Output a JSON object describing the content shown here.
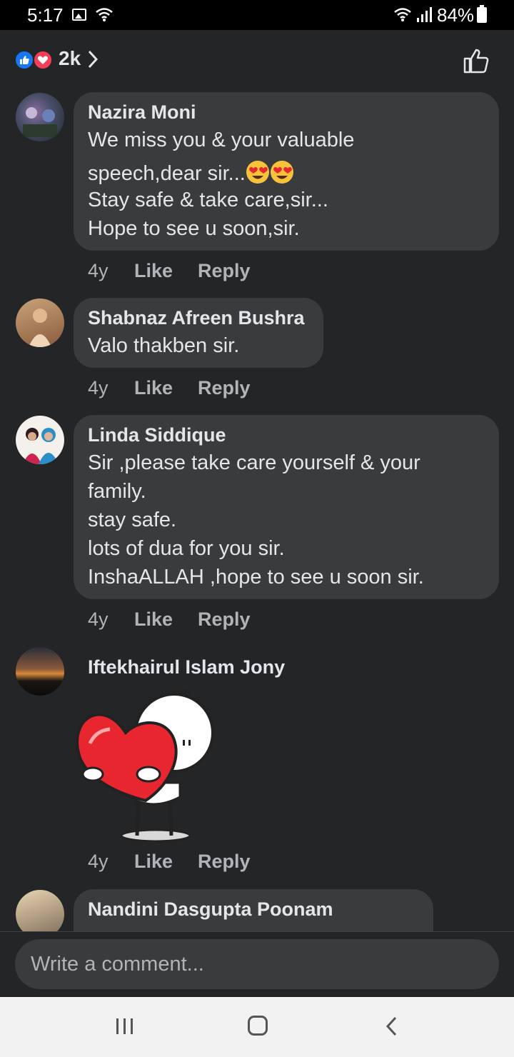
{
  "status_bar": {
    "time": "5:17",
    "battery": "84%"
  },
  "header": {
    "reaction_count": "2k"
  },
  "comments": [
    {
      "name": "Nazira Moni",
      "lines": [
        "We miss you & your valuable",
        "speech,dear sir...",
        "Stay safe & take care,sir...",
        "Hope to see u soon,sir."
      ],
      "time": "4y",
      "like": "Like",
      "reply": "Reply"
    },
    {
      "name": "Shabnaz Afreen Bushra",
      "lines": [
        "Valo thakben sir."
      ],
      "time": "4y",
      "like": "Like",
      "reply": "Reply"
    },
    {
      "name": "Linda Siddique",
      "lines": [
        "Sir ,please take care yourself & your",
        "family.",
        "stay safe.",
        "lots of dua for you sir.",
        "InshaALLAH ,hope to see u soon sir."
      ],
      "time": "4y",
      "like": "Like",
      "reply": "Reply"
    },
    {
      "name": "Iftekhairul Islam Jony",
      "sticker": "heart-hug-sticker",
      "time": "4y",
      "like": "Like",
      "reply": "Reply"
    },
    {
      "name": "Nandini Dasgupta Poonam"
    }
  ],
  "composer": {
    "placeholder": "Write a comment..."
  },
  "colors": {
    "background": "#242526",
    "bubble": "#3a3b3c",
    "like_blue": "#1877f2",
    "love_red": "#f33e58",
    "heart_red": "#e8262f"
  }
}
